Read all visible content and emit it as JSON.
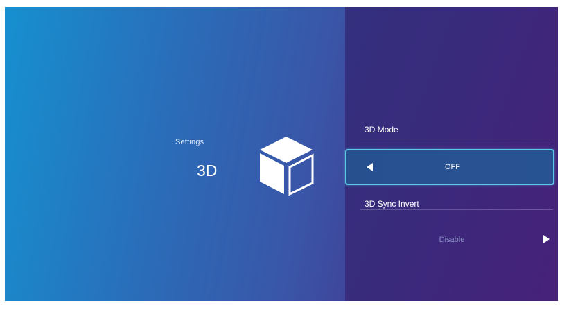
{
  "header": {
    "caption": "Settings",
    "title": "3D",
    "icon": "cube-icon"
  },
  "settings": {
    "mode": {
      "label": "3D Mode",
      "value": "OFF",
      "prev_icon": "arrow-left-icon"
    },
    "sync_invert": {
      "label": "3D Sync Invert",
      "value": "Disable",
      "next_icon": "arrow-right-icon"
    }
  },
  "colors": {
    "focus_border": "#5bc8e8",
    "gradient_start": "#1690d0",
    "gradient_end": "#4a1f74"
  }
}
